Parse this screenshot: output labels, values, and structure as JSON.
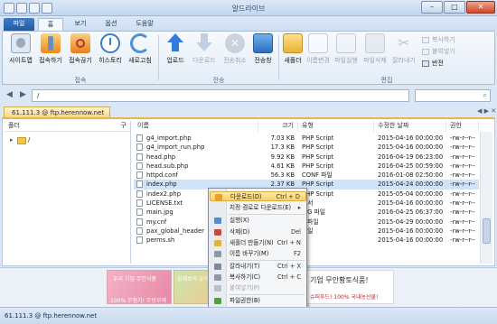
{
  "window": {
    "title": "알드라이브"
  },
  "tabs": [
    {
      "label": "파일"
    },
    {
      "label": "홈"
    },
    {
      "label": "보기"
    },
    {
      "label": "옵션"
    },
    {
      "label": "도움말"
    }
  ],
  "ribbon": {
    "connect_group": {
      "label": "접속",
      "buttons": [
        {
          "label": "사이트맵",
          "icon": "sitemap-icon"
        },
        {
          "label": "접속하기",
          "icon": "connect-icon"
        },
        {
          "label": "접속끊기",
          "icon": "disconnect-icon"
        },
        {
          "label": "히스토리",
          "icon": "history-icon"
        },
        {
          "label": "새로고침",
          "icon": "refresh-icon"
        }
      ]
    },
    "transfer_group": {
      "label": "전송",
      "buttons": [
        {
          "label": "업로드",
          "icon": "upload-icon"
        },
        {
          "label": "다운로드",
          "icon": "download-icon"
        },
        {
          "label": "전송취소",
          "icon": "cancel-transfer-icon"
        },
        {
          "label": "전송창",
          "icon": "transfer-window-icon"
        }
      ]
    },
    "edit_group": {
      "label": "편집",
      "buttons": [
        {
          "label": "새폴더",
          "icon": "new-folder-icon"
        },
        {
          "label": "이름변경",
          "icon": "rename-icon"
        },
        {
          "label": "파일실행",
          "icon": "run-file-icon"
        },
        {
          "label": "파일삭제",
          "icon": "delete-file-icon"
        },
        {
          "label": "잘라내기",
          "icon": "cut-icon"
        }
      ],
      "small": [
        {
          "label": "복사하기"
        },
        {
          "label": "붙여넣기"
        },
        {
          "label": "반전"
        }
      ]
    }
  },
  "address": {
    "path": "/"
  },
  "connection_tab": {
    "label": "61.111.3 @ ftp.herennow.net"
  },
  "tree": {
    "header": "폴더",
    "sort_glyph": "구",
    "root": "/"
  },
  "columns": {
    "name": "이름",
    "size": "크기",
    "type": "유형",
    "modified": "수정한 날짜",
    "perm": "권한"
  },
  "files": [
    {
      "name": "g4_import.php",
      "size": "7.03 KB",
      "type": "PHP Script",
      "modified": "2015-04-16 00:00:00",
      "perm": "-rw-r--r--"
    },
    {
      "name": "g4_import_run.php",
      "size": "17.3 KB",
      "type": "PHP Script",
      "modified": "2015-04-16 00:00:00",
      "perm": "-rw-r--r--"
    },
    {
      "name": "head.php",
      "size": "9.92 KB",
      "type": "PHP Script",
      "modified": "2016-04-19 06:23:00",
      "perm": "-rw-r--r--"
    },
    {
      "name": "head.sub.php",
      "size": "4.61 KB",
      "type": "PHP Script",
      "modified": "2016-04-25 00:59:00",
      "perm": "-rw-r--r--"
    },
    {
      "name": "httpd.conf",
      "size": "56.3 KB",
      "type": "CONF 파일",
      "modified": "2016-01-08 02:50:00",
      "perm": "-rw-r--r--"
    },
    {
      "name": "index.php",
      "size": "2.37 KB",
      "type": "PHP Script",
      "modified": "2015-04-24 00:00:00",
      "perm": "-rw-r--r--"
    },
    {
      "name": "index2.php",
      "size": "",
      "type": "PHP Script",
      "modified": "2015-05-04 00:00:00",
      "perm": "-rw-r--r--"
    },
    {
      "name": "LICENSE.txt",
      "size": "",
      "type": "문서",
      "modified": "2015-04-16 00:00:00",
      "perm": "-rw-r--r--"
    },
    {
      "name": "main.jpg",
      "size": "",
      "type": "JPG 파일",
      "modified": "2016-04-25 06:37:00",
      "perm": "-rw-r--r--"
    },
    {
      "name": "my.cnf",
      "size": "",
      "type": "F 파일",
      "modified": "2015-04-29 00:00:00",
      "perm": "-rw-r--r--"
    },
    {
      "name": "pax_global_header",
      "size": "",
      "type": "파일",
      "modified": "2015-04-16 00:00:00",
      "perm": "-rw-r--r--"
    },
    {
      "name": "perms.sh",
      "size": "",
      "type": "",
      "modified": "2015-04-16 00:00:00",
      "perm": "-rw-r--r--"
    }
  ],
  "context_menu": {
    "items": [
      {
        "label": "다운로드(D)",
        "key": "Ctrl + D",
        "icon": "download-icon"
      },
      {
        "label": "지정 경로로 다운로드(E)",
        "key": "▸",
        "icon": ""
      },
      {
        "label": "실행(X)",
        "key": "",
        "icon": "run-icon"
      },
      {
        "label": "삭제(D)",
        "key": "Del",
        "icon": "delete-icon"
      },
      {
        "label": "새폴더 만들기(N)",
        "key": "Ctrl + N",
        "icon": "new-folder-icon"
      },
      {
        "label": "이름 바꾸기(M)",
        "key": "F2",
        "icon": "rename-icon"
      },
      {
        "label": "잘라내기(T)",
        "key": "Ctrl + X",
        "icon": "cut-icon"
      },
      {
        "label": "복사하기(C)",
        "key": "Ctrl + C",
        "icon": "copy-icon"
      },
      {
        "label": "붙여넣기(P)",
        "key": "",
        "icon": "paste-icon"
      },
      {
        "label": "파일권한(B)",
        "key": "",
        "icon": "permissions-icon"
      },
      {
        "label": "새로고침(R)",
        "key": "F5",
        "icon": "refresh-icon"
      }
    ]
  },
  "ads": {
    "ad1": {
      "text_top": "우리 기업 무인식품",
      "text_bottom": "100% 무첨가! 무방부제"
    },
    "ad2": {
      "text_top": "원재료의 유익한"
    },
    "ad3": {
      "text_main": "기업 무안황토식품!",
      "text_sub": "슈퍼푸드! 100% 국내농산물!"
    }
  },
  "status": {
    "text": "61.111.3 @ ftp.herennow.net"
  },
  "colors": {
    "accent": "#1f5aa6",
    "tab_active": "#f6d57a",
    "highlight": "#f8d26a"
  }
}
